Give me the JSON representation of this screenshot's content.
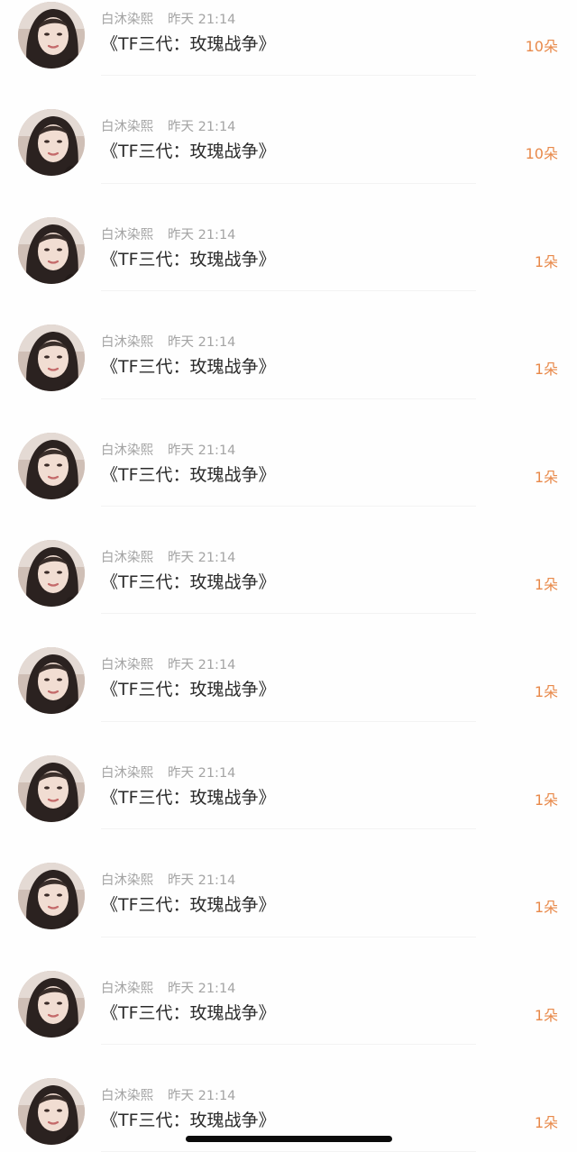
{
  "items": [
    {
      "user": "白沐染熙",
      "time": "昨天 21:14",
      "title": "《TF三代：玫瑰战争》",
      "count": "10朵"
    },
    {
      "user": "白沐染熙",
      "time": "昨天 21:14",
      "title": "《TF三代：玫瑰战争》",
      "count": "10朵"
    },
    {
      "user": "白沐染熙",
      "time": "昨天 21:14",
      "title": "《TF三代：玫瑰战争》",
      "count": "1朵"
    },
    {
      "user": "白沐染熙",
      "time": "昨天 21:14",
      "title": "《TF三代：玫瑰战争》",
      "count": "1朵"
    },
    {
      "user": "白沐染熙",
      "time": "昨天 21:14",
      "title": "《TF三代：玫瑰战争》",
      "count": "1朵"
    },
    {
      "user": "白沐染熙",
      "time": "昨天 21:14",
      "title": "《TF三代：玫瑰战争》",
      "count": "1朵"
    },
    {
      "user": "白沐染熙",
      "time": "昨天 21:14",
      "title": "《TF三代：玫瑰战争》",
      "count": "1朵"
    },
    {
      "user": "白沐染熙",
      "time": "昨天 21:14",
      "title": "《TF三代：玫瑰战争》",
      "count": "1朵"
    },
    {
      "user": "白沐染熙",
      "time": "昨天 21:14",
      "title": "《TF三代：玫瑰战争》",
      "count": "1朵"
    },
    {
      "user": "白沐染熙",
      "time": "昨天 21:14",
      "title": "《TF三代：玫瑰战争》",
      "count": "1朵"
    },
    {
      "user": "白沐染熙",
      "time": "昨天 21:14",
      "title": "《TF三代：玫瑰战争》",
      "count": "1朵"
    }
  ],
  "colors": {
    "count_accent": "#e8894a",
    "meta_gray": "#a4a4a4",
    "title_text": "#2b2b2b"
  },
  "icons": {
    "avatar": "user-photo-avatar"
  }
}
